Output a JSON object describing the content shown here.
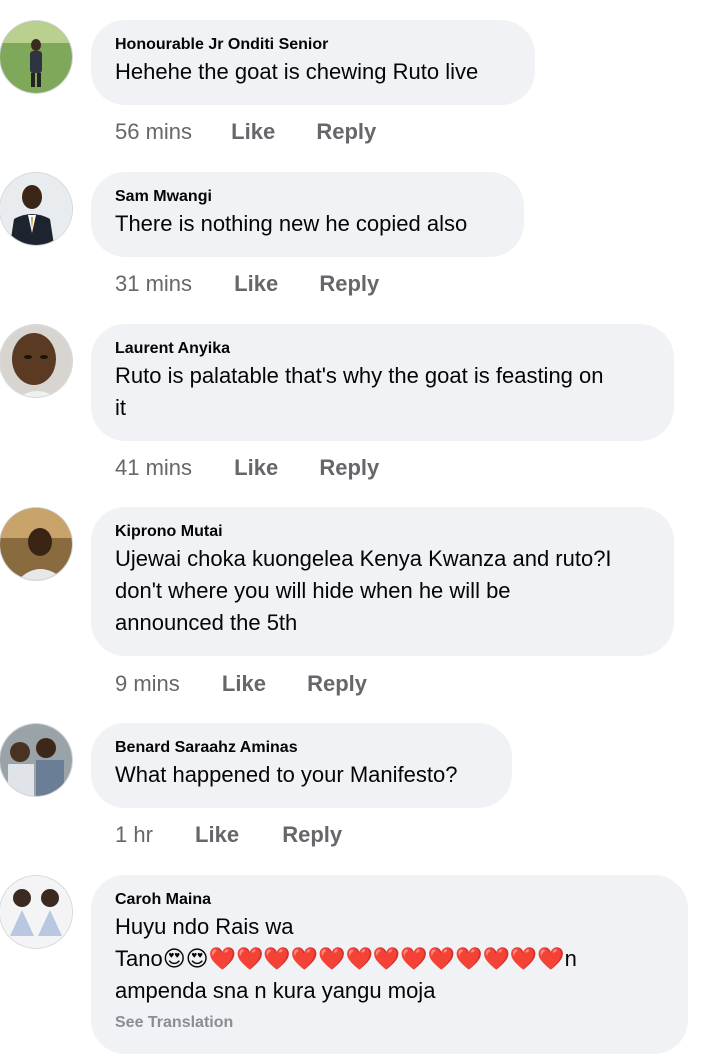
{
  "comments": [
    {
      "author": "Honourable Jr Onditi Senior",
      "text": "Hehehe the goat is chewing Ruto live",
      "time": "56 mins",
      "like": "Like",
      "reply": "Reply"
    },
    {
      "author": "Sam Mwangi",
      "text": "There is nothing new he copied also",
      "time": "31 mins",
      "like": "Like",
      "reply": "Reply"
    },
    {
      "author": "Laurent Anyika",
      "text_lines": [
        "Ruto is palatable that's why the goat is feasting on",
        "it"
      ],
      "time": "41 mins",
      "like": "Like",
      "reply": "Reply"
    },
    {
      "author": "Kiprono Mutai",
      "text_lines": [
        "Ujewai choka kuongelea Kenya Kwanza and ruto?I",
        "don't where you will hide when he will be",
        "announced the 5th"
      ],
      "time": "9 mins",
      "like": "Like",
      "reply": "Reply"
    },
    {
      "author": "Benard Saraahz Aminas",
      "text": "What happened to your Manifesto?",
      "time": "1 hr",
      "like": "Like",
      "reply": "Reply"
    },
    {
      "author": "Caroh Maina",
      "text_lines": [
        "Huyu ndo Rais wa",
        "Tano😍😍❤️❤️❤️❤️❤️❤️❤️❤️❤️❤️❤️❤️❤️n",
        "ampenda sna n kura yangu moja"
      ],
      "see_translation": "See Translation"
    }
  ]
}
